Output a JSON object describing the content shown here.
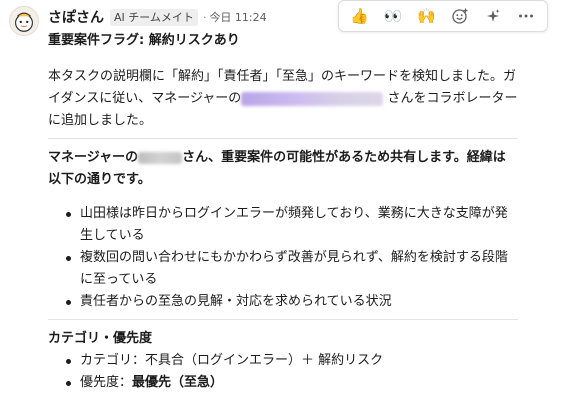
{
  "message": {
    "author": "さぽさん",
    "app_badge": "AI チームメイト",
    "separator": "·",
    "timestamp": "今日 11:24",
    "title": "重要案件フラグ: 解約リスクあり",
    "para1": {
      "part1": "本タスクの説明欄に「解約」「責任者」「至急」のキーワードを検知しました。ガイダンスに従い、マネージャーの",
      "part2": "さんをコラボレーターに追加しました。"
    },
    "section1": {
      "prefix": "マネージャーの",
      "suffix": "さん、重要案件の可能性があるため共有します。経緯は以下の通りです。"
    },
    "bullets1": [
      "山田様は昨日からログインエラーが頻発しており、業務に大きな支障が発生している",
      "複数回の問い合わせにもかかわらず改善が見られず、解約を検討する段階に至っている",
      "責任者からの至急の見解・対応を求められている状況"
    ],
    "section2": {
      "heading": "カテゴリ・優先度",
      "category_label": "カテゴリ：",
      "category_value": "不具合（ログインエラー）＋ 解約リスク",
      "priority_label": "優先度：",
      "priority_value": "最優先（至急）"
    }
  },
  "toolbar": {
    "items": [
      {
        "icon": "thumbs-up-icon",
        "glyph": "👍"
      },
      {
        "icon": "eyes-icon",
        "glyph": "👀"
      },
      {
        "icon": "raised-hands-icon",
        "glyph": "🙌"
      },
      {
        "icon": "add-reaction-icon"
      },
      {
        "icon": "sparkles-icon"
      },
      {
        "icon": "more-actions-icon"
      }
    ]
  },
  "colors": {
    "mention_highlight": "#cdbcf0",
    "text": "#1d1c1d",
    "muted": "#616061"
  }
}
